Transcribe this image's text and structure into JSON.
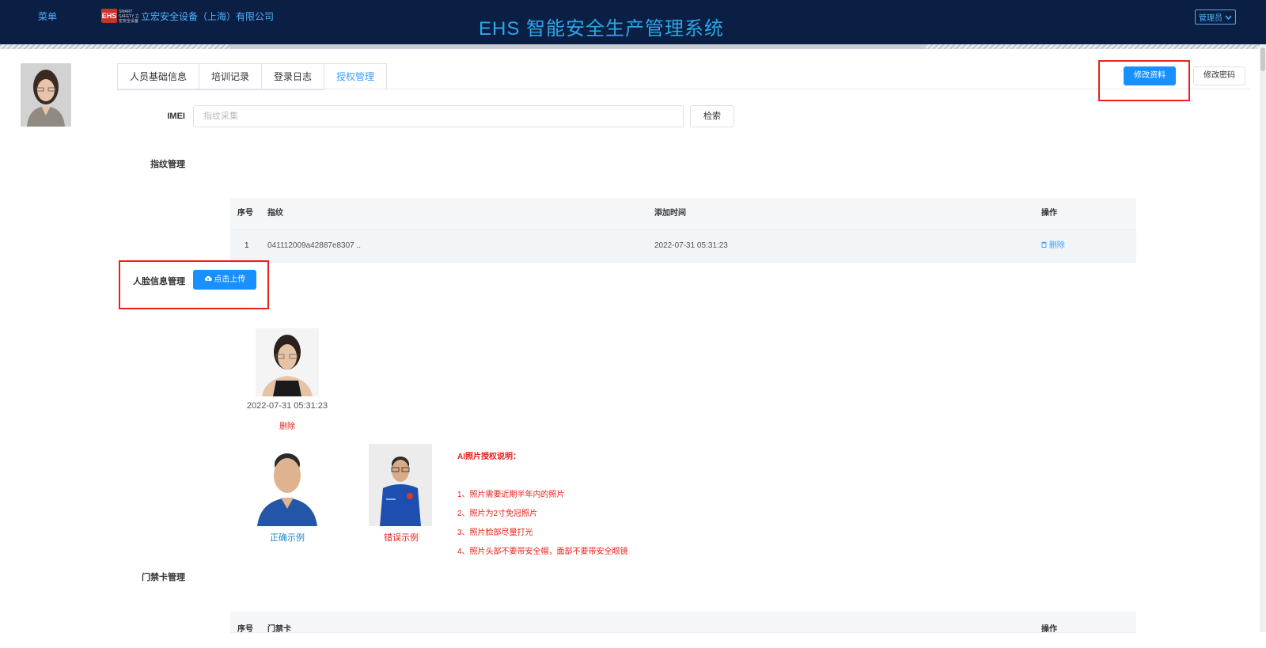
{
  "header": {
    "menu": "菜单",
    "logo_text": "EHS",
    "logo_sub": "SMART SAFETY 立宏安全设备",
    "company": "立宏安全设备（上海）有限公司",
    "title": "EHS 智能安全生产管理系统",
    "admin": "管理员"
  },
  "tabs": [
    "人员基础信息",
    "培训记录",
    "登录日志",
    "授权管理"
  ],
  "actions": {
    "edit_profile": "修改资料",
    "change_password": "修改密码"
  },
  "imei": {
    "label": "IMEI",
    "placeholder": "指纹采集",
    "search": "检索"
  },
  "fingerprint": {
    "label": "指纹管理",
    "columns": [
      "序号",
      "指纹",
      "添加时间",
      "操作"
    ],
    "rows": [
      {
        "index": "1",
        "fingerprint": "041112009a42887e8307 ..",
        "added": "2022-07-31 05:31:23",
        "action": "删除"
      }
    ]
  },
  "face": {
    "label": "人脸信息管理",
    "upload": "点击上传",
    "photo_time": "2022-07-31 05:31:23",
    "delete": "删除",
    "correct_example": "正确示例",
    "wrong_example": "错误示例"
  },
  "ai_rules": {
    "title": "AI照片授权说明：",
    "items": [
      "1、照片需要近期半年内的照片",
      "2、照片为2寸免冠照片",
      "3、照片脸部尽量打光",
      "4、照片头部不要带安全帽，面部不要带安全眼镜"
    ]
  },
  "access_card": {
    "label": "门禁卡管理",
    "columns": [
      "序号",
      "门禁卡",
      "操作"
    ]
  },
  "colors": {
    "header_bg": "#0b1f44",
    "accent": "#1890ff",
    "highlight": "#e8221a"
  }
}
